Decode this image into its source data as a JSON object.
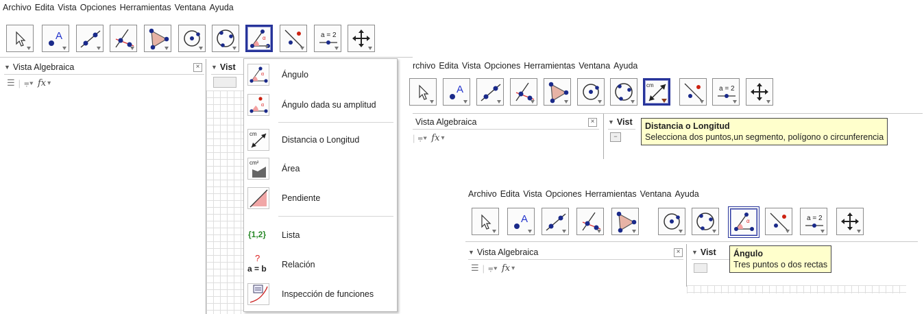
{
  "menu": [
    "Archivo",
    "Edita",
    "Vista",
    "Opciones",
    "Herramientas",
    "Ventana",
    "Ayuda"
  ],
  "menu_second_visible": [
    "rchivo",
    "Edita",
    "Vista",
    "Opciones",
    "Herramientas",
    "Ventana",
    "Ayuda"
  ],
  "tools": [
    "move",
    "point",
    "line",
    "perpendicular",
    "polygon",
    "circle-center",
    "circle-3pts",
    "angle",
    "reflect",
    "slider",
    "move-view"
  ],
  "slider_label": "a = 2",
  "algebra_view": {
    "title": "Vista Algebraica",
    "fx": "fx",
    "graphics_title": "Vist"
  },
  "dropdown": {
    "items": [
      {
        "label": "Ángulo",
        "icon": "angle-icon"
      },
      {
        "label": "Ángulo dada su amplitud",
        "icon": "angle-fixed-icon"
      },
      {
        "label": "Distancia o Longitud",
        "icon": "distance-icon",
        "cm": "cm"
      },
      {
        "label": "Área",
        "icon": "area-icon",
        "cm2": "cm²"
      },
      {
        "label": "Pendiente",
        "icon": "slope-icon"
      },
      {
        "label": "Lista",
        "icon": "list-icon",
        "glyph": "{1,2}"
      },
      {
        "label": "Relación",
        "icon": "relation-icon",
        "glyph_top": "?",
        "glyph_bottom": "a = b"
      },
      {
        "label": "Inspección de funciones",
        "icon": "function-inspector-icon"
      }
    ]
  },
  "tooltip_distance": {
    "title": "Distancia o Longitud",
    "text": "Selecciona dos puntos,un segmento, polígono o circunferencia"
  },
  "tooltip_angle": {
    "title": "Ángulo",
    "text": "Tres puntos o dos rectas"
  },
  "colors": {
    "selected_border": "#27349a",
    "tooltip_bg": "#ffffcc",
    "point_blue": "#1a2a8a"
  }
}
